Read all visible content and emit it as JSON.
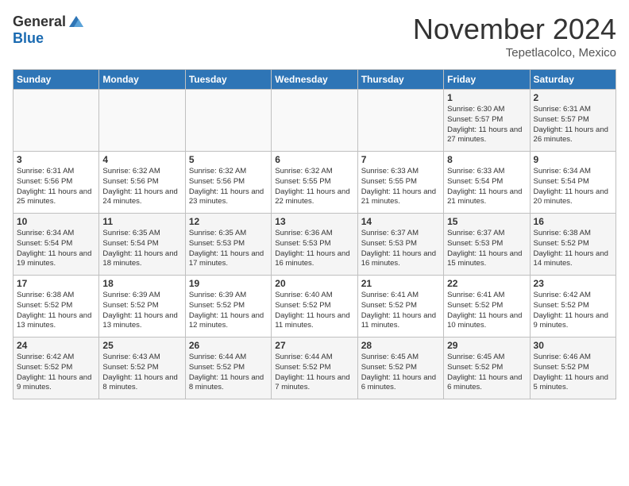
{
  "header": {
    "logo_general": "General",
    "logo_blue": "Blue",
    "month_title": "November 2024",
    "subtitle": "Tepetlacolco, Mexico"
  },
  "calendar": {
    "days_of_week": [
      "Sunday",
      "Monday",
      "Tuesday",
      "Wednesday",
      "Thursday",
      "Friday",
      "Saturday"
    ],
    "weeks": [
      [
        {
          "day": "",
          "info": ""
        },
        {
          "day": "",
          "info": ""
        },
        {
          "day": "",
          "info": ""
        },
        {
          "day": "",
          "info": ""
        },
        {
          "day": "",
          "info": ""
        },
        {
          "day": "1",
          "info": "Sunrise: 6:30 AM\nSunset: 5:57 PM\nDaylight: 11 hours and 27 minutes."
        },
        {
          "day": "2",
          "info": "Sunrise: 6:31 AM\nSunset: 5:57 PM\nDaylight: 11 hours and 26 minutes."
        }
      ],
      [
        {
          "day": "3",
          "info": "Sunrise: 6:31 AM\nSunset: 5:56 PM\nDaylight: 11 hours and 25 minutes."
        },
        {
          "day": "4",
          "info": "Sunrise: 6:32 AM\nSunset: 5:56 PM\nDaylight: 11 hours and 24 minutes."
        },
        {
          "day": "5",
          "info": "Sunrise: 6:32 AM\nSunset: 5:56 PM\nDaylight: 11 hours and 23 minutes."
        },
        {
          "day": "6",
          "info": "Sunrise: 6:32 AM\nSunset: 5:55 PM\nDaylight: 11 hours and 22 minutes."
        },
        {
          "day": "7",
          "info": "Sunrise: 6:33 AM\nSunset: 5:55 PM\nDaylight: 11 hours and 21 minutes."
        },
        {
          "day": "8",
          "info": "Sunrise: 6:33 AM\nSunset: 5:54 PM\nDaylight: 11 hours and 21 minutes."
        },
        {
          "day": "9",
          "info": "Sunrise: 6:34 AM\nSunset: 5:54 PM\nDaylight: 11 hours and 20 minutes."
        }
      ],
      [
        {
          "day": "10",
          "info": "Sunrise: 6:34 AM\nSunset: 5:54 PM\nDaylight: 11 hours and 19 minutes."
        },
        {
          "day": "11",
          "info": "Sunrise: 6:35 AM\nSunset: 5:54 PM\nDaylight: 11 hours and 18 minutes."
        },
        {
          "day": "12",
          "info": "Sunrise: 6:35 AM\nSunset: 5:53 PM\nDaylight: 11 hours and 17 minutes."
        },
        {
          "day": "13",
          "info": "Sunrise: 6:36 AM\nSunset: 5:53 PM\nDaylight: 11 hours and 16 minutes."
        },
        {
          "day": "14",
          "info": "Sunrise: 6:37 AM\nSunset: 5:53 PM\nDaylight: 11 hours and 16 minutes."
        },
        {
          "day": "15",
          "info": "Sunrise: 6:37 AM\nSunset: 5:53 PM\nDaylight: 11 hours and 15 minutes."
        },
        {
          "day": "16",
          "info": "Sunrise: 6:38 AM\nSunset: 5:52 PM\nDaylight: 11 hours and 14 minutes."
        }
      ],
      [
        {
          "day": "17",
          "info": "Sunrise: 6:38 AM\nSunset: 5:52 PM\nDaylight: 11 hours and 13 minutes."
        },
        {
          "day": "18",
          "info": "Sunrise: 6:39 AM\nSunset: 5:52 PM\nDaylight: 11 hours and 13 minutes."
        },
        {
          "day": "19",
          "info": "Sunrise: 6:39 AM\nSunset: 5:52 PM\nDaylight: 11 hours and 12 minutes."
        },
        {
          "day": "20",
          "info": "Sunrise: 6:40 AM\nSunset: 5:52 PM\nDaylight: 11 hours and 11 minutes."
        },
        {
          "day": "21",
          "info": "Sunrise: 6:41 AM\nSunset: 5:52 PM\nDaylight: 11 hours and 11 minutes."
        },
        {
          "day": "22",
          "info": "Sunrise: 6:41 AM\nSunset: 5:52 PM\nDaylight: 11 hours and 10 minutes."
        },
        {
          "day": "23",
          "info": "Sunrise: 6:42 AM\nSunset: 5:52 PM\nDaylight: 11 hours and 9 minutes."
        }
      ],
      [
        {
          "day": "24",
          "info": "Sunrise: 6:42 AM\nSunset: 5:52 PM\nDaylight: 11 hours and 9 minutes."
        },
        {
          "day": "25",
          "info": "Sunrise: 6:43 AM\nSunset: 5:52 PM\nDaylight: 11 hours and 8 minutes."
        },
        {
          "day": "26",
          "info": "Sunrise: 6:44 AM\nSunset: 5:52 PM\nDaylight: 11 hours and 8 minutes."
        },
        {
          "day": "27",
          "info": "Sunrise: 6:44 AM\nSunset: 5:52 PM\nDaylight: 11 hours and 7 minutes."
        },
        {
          "day": "28",
          "info": "Sunrise: 6:45 AM\nSunset: 5:52 PM\nDaylight: 11 hours and 6 minutes."
        },
        {
          "day": "29",
          "info": "Sunrise: 6:45 AM\nSunset: 5:52 PM\nDaylight: 11 hours and 6 minutes."
        },
        {
          "day": "30",
          "info": "Sunrise: 6:46 AM\nSunset: 5:52 PM\nDaylight: 11 hours and 5 minutes."
        }
      ]
    ]
  }
}
